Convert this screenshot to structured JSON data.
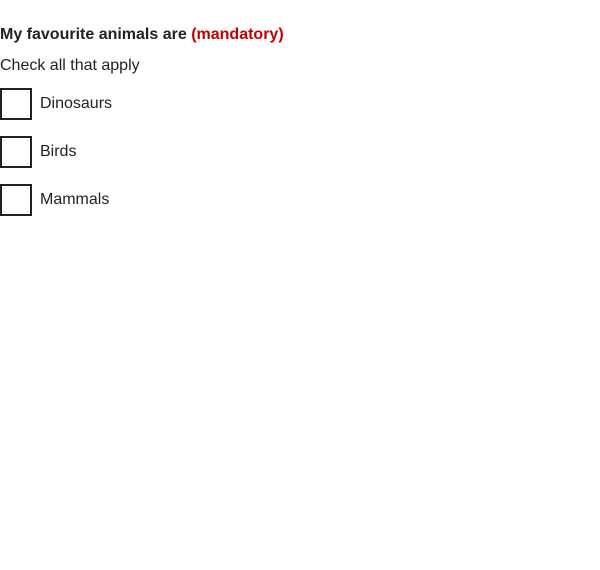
{
  "question": {
    "legend_text": "My favourite animals are",
    "required_marker": "(mandatory)",
    "hint": "Check all that apply"
  },
  "options": [
    {
      "label": "Dinosaurs",
      "checked": false
    },
    {
      "label": "Birds",
      "checked": false
    },
    {
      "label": "Mammals",
      "checked": false
    }
  ],
  "colors": {
    "text": "#222222",
    "required": "#c00000",
    "checkbox_border": "#222222"
  }
}
